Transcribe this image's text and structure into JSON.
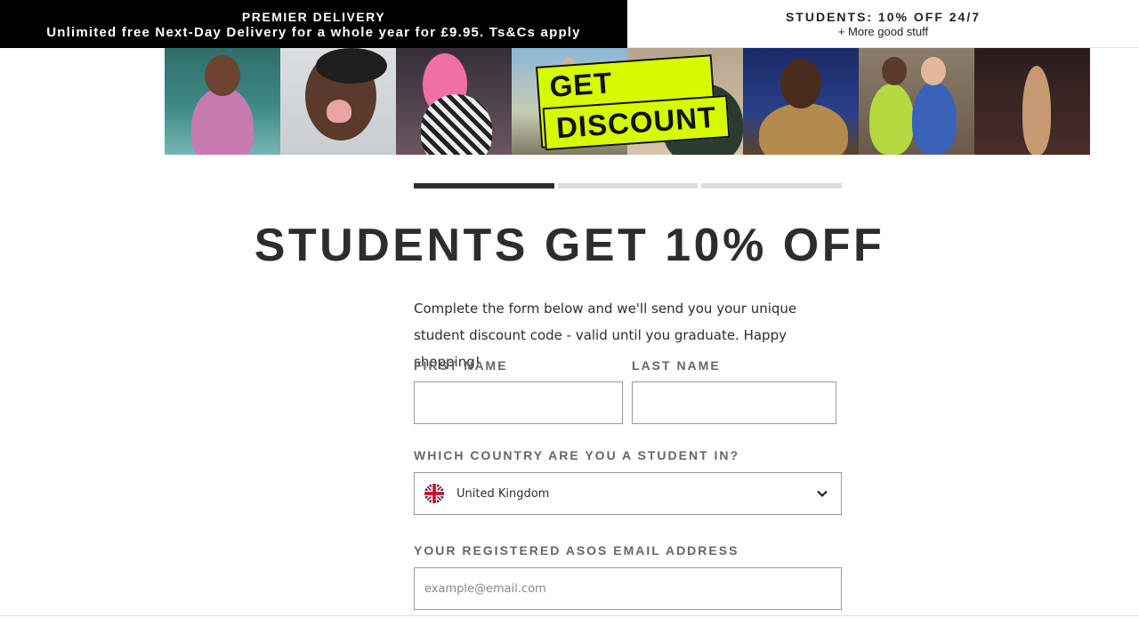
{
  "promo": {
    "left_title": "PREMIER DELIVERY",
    "left_subtitle": "Unlimited free Next-Day Delivery for a whole year for £9.95. Ts&Cs apply",
    "right_title": "STUDENTS: 10% OFF 24/7",
    "right_subtitle": "+ More good stuff"
  },
  "hero": {
    "discount_line1": "GET YOUR",
    "discount_line2": "DISCOUNT"
  },
  "progress": {
    "steps": 3,
    "current_step": 1
  },
  "page": {
    "title": "STUDENTS GET 10% OFF",
    "intro": "Complete the form below and we'll send you your unique student discount code - valid until you graduate. Happy shopping!"
  },
  "form": {
    "first_name_label": "FIRST NAME",
    "last_name_label": "LAST NAME",
    "first_name_value": "",
    "last_name_value": "",
    "country_label": "WHICH COUNTRY ARE YOU A STUDENT IN?",
    "country_value": "United Kingdom",
    "country_flag_icon": "uk-flag-icon",
    "email_label": "YOUR REGISTERED ASOS EMAIL ADDRESS",
    "email_placeholder": "example@email.com"
  },
  "colors": {
    "accent": "#d6fb00",
    "dark": "#2d2d2d",
    "promo_bg": "#000000"
  }
}
